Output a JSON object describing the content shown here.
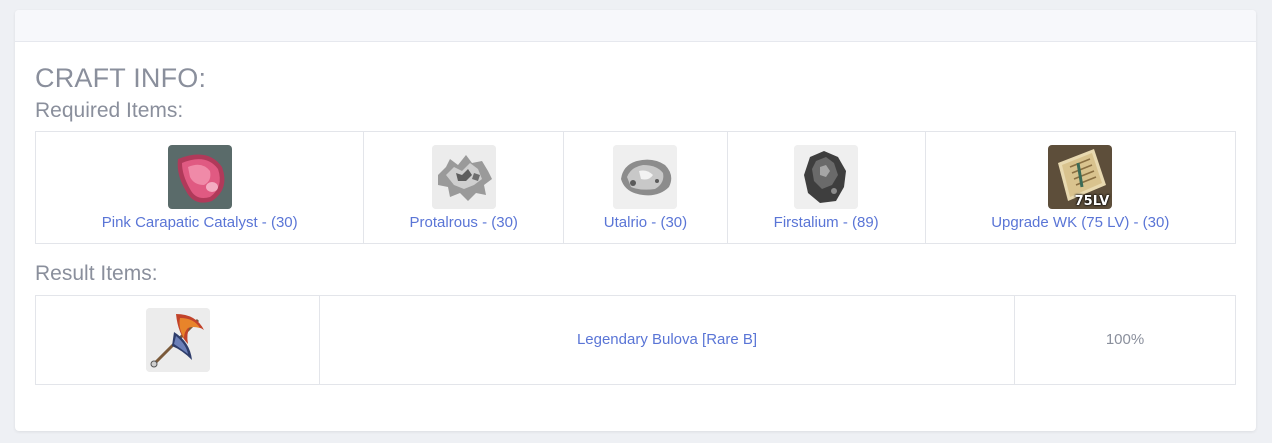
{
  "craft": {
    "title": "CRAFT INFO:",
    "required_heading": "Required Items:",
    "result_heading": "Result Items:"
  },
  "required_items": [
    {
      "label": "Pink Carapatic Catalyst - (30)",
      "icon": "pink-gem-icon"
    },
    {
      "label": "Protalrous - (30)",
      "icon": "silver-ore-icon"
    },
    {
      "label": "Utalrio - (30)",
      "icon": "grey-ore-icon"
    },
    {
      "label": "Firstalium - (89)",
      "icon": "dark-ore-icon"
    },
    {
      "label": "Upgrade WK (75 LV) - (30)",
      "icon": "scroll-icon",
      "badge": "75LV"
    }
  ],
  "result_items": [
    {
      "label": "Legendary Bulova [Rare B]",
      "chance": "100%",
      "icon": "axe-weapon-icon"
    }
  ]
}
